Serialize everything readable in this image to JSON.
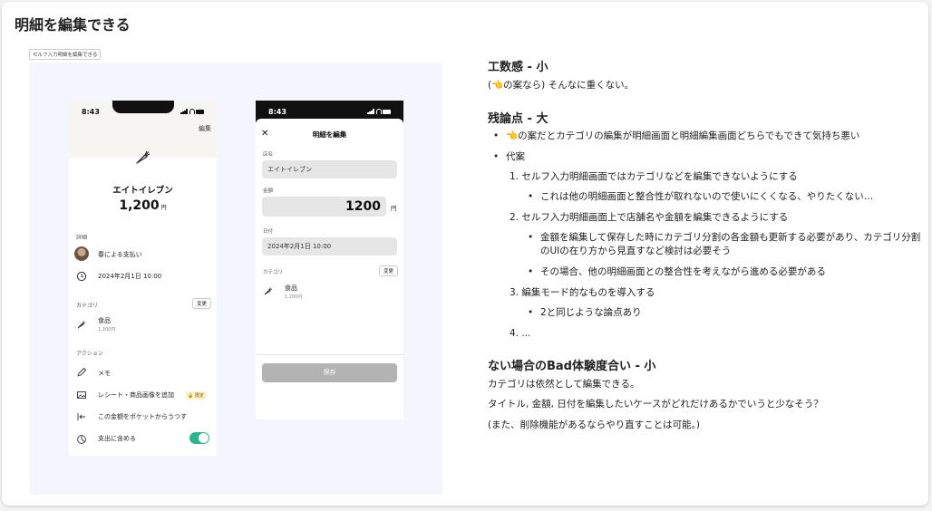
{
  "page_title": "明細を編集できる",
  "frame_label": "セルフ入力明細を編集できる",
  "phone1": {
    "time": "8:43",
    "edit_label": "編集",
    "store_name": "エイトイレブン",
    "amount": "1,200",
    "yen": "円",
    "detail_section": "詳細",
    "payer": "春による支払い",
    "datetime": "2024年2月1日 10:00",
    "category_section": "カテゴリ",
    "change_button": "変更",
    "category_name": "食品",
    "category_amount": "1,200円",
    "action_section": "アクション",
    "memo": "メモ",
    "add_receipt": "レシート・商品画像を追加",
    "limited_badge": "限定",
    "move_to_pocket": "この金額をポケットからうつす",
    "include_expense": "支出に含める",
    "include_toggle": "on"
  },
  "phone2": {
    "time": "8:43",
    "close": "✕",
    "title": "明細を編集",
    "store_label": "店名",
    "store_value": "エイトイレブン",
    "amount_label": "金額",
    "amount_value": "1200",
    "yen": "円",
    "date_label": "日付",
    "date_value": "2024年2月1日 10:00",
    "category_label": "カテゴリ",
    "change_button": "変更",
    "category_name": "食品",
    "category_amount": "1,200円",
    "save_button": "保存"
  },
  "notes": {
    "effort_heading": "工数感 - 小",
    "effort_text": "(👈の案なら) そんなに重くない。",
    "issues_heading": "残論点 - 大",
    "issue_1": "👈の案だとカテゴリの編集が明細画面と明細編集画面どちらでもできて気持ち悪い",
    "issue_2": "代案",
    "alt_1_num": "1.",
    "alt_1": "セルフ入力明細画面ではカテゴリなどを編集できないようにする",
    "alt_1_sub": "これは他の明細画面と整合性が取れないので使いにくくなる、やりたくない…",
    "alt_2_num": "2.",
    "alt_2": "セルフ入力明細画面上で店舗名や金額を編集できるようにする",
    "alt_2_sub1": "金額を編集して保存した時にカテゴリ分割の各金額も更新する必要があり、カテゴリ分割のUIの在り方から見直すなど検討は必要そう",
    "alt_2_sub2": "その場合、他の明細画面との整合性を考えながら進める必要がある",
    "alt_3_num": "3.",
    "alt_3": "編集モード的なものを導入する",
    "alt_3_sub": "2と同じような論点あり",
    "alt_4_num": "4.",
    "alt_4": "...",
    "bad_heading": "ない場合のBad体験度合い - 小",
    "bad_line1": "カテゴリは依然として編集できる。",
    "bad_line2": "タイトル, 金額, 日付を編集したいケースがどれだけあるかでいうと少なそう？",
    "bad_line3": "(また、削除機能があるならやり直すことは可能。)"
  },
  "colors": {
    "toggle_on": "#2bb58c",
    "canvas_bg": "#f5f5fd",
    "save_disabled": "#b3b3b3"
  }
}
